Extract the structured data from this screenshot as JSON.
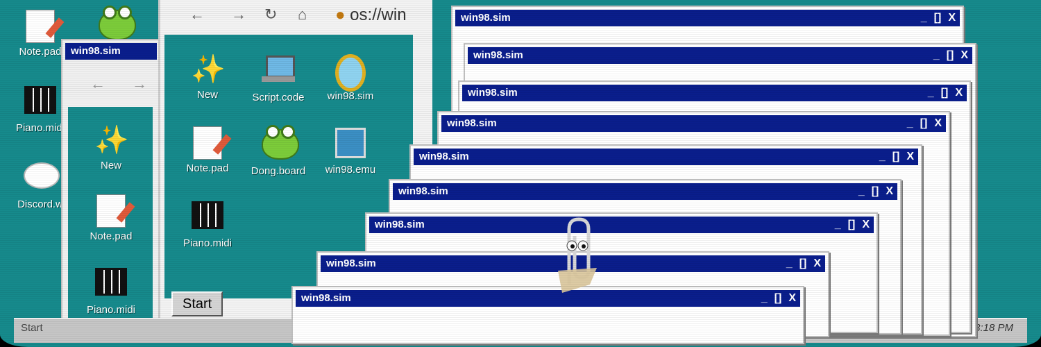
{
  "desktop": {
    "icons": [
      {
        "label": "Note.pad",
        "icon": "notepad-icon"
      },
      {
        "label": "Piano.midi",
        "icon": "piano-icon"
      },
      {
        "label": "Discord.w",
        "icon": "chat-bubble-icon"
      },
      {
        "label": "",
        "icon": "frog-icon"
      }
    ]
  },
  "browser": {
    "address": "os://win",
    "nav_icons": [
      "back-arrow-icon",
      "forward-arrow-icon",
      "reload-icon",
      "home-icon"
    ],
    "icons": [
      {
        "label": "New",
        "icon": "sparkle-icon"
      },
      {
        "label": "Script.code",
        "icon": "laptop-icon"
      },
      {
        "label": "win98.sim",
        "icon": "mirror-icon"
      },
      {
        "label": "Note.pad",
        "icon": "notepad-icon"
      },
      {
        "label": "Dong.board",
        "icon": "frog-icon"
      },
      {
        "label": "win98.emu",
        "icon": "window-icon"
      },
      {
        "label": "Piano.midi",
        "icon": "piano-icon"
      }
    ],
    "start_label": "Start"
  },
  "left_window": {
    "title": "win98.sim",
    "icons": [
      {
        "label": "New",
        "icon": "sparkle-icon"
      },
      {
        "label": "Note.pad",
        "icon": "notepad-icon"
      },
      {
        "label": "Piano.midi",
        "icon": "piano-icon"
      }
    ]
  },
  "stacked_windows": {
    "title": "win98.sim",
    "controls": {
      "minimize": "_",
      "maximize": "[]",
      "close": "X"
    }
  },
  "taskbar": {
    "start_label": "Start",
    "clock": "3:18 PM"
  }
}
